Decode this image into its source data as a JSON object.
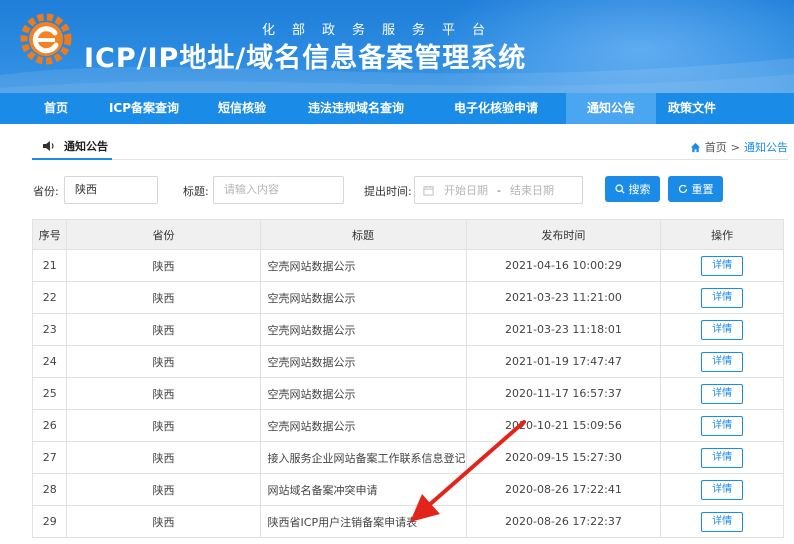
{
  "header": {
    "subtitle": "化部政务服务平台",
    "title": "ICP/IP地址/域名信息备案管理系统"
  },
  "nav": {
    "items": [
      {
        "label": "首页"
      },
      {
        "label": "ICP备案查询"
      },
      {
        "label": "短信核验"
      },
      {
        "label": "违法违规域名查询"
      },
      {
        "label": "电子化核验申请"
      },
      {
        "label": "通知公告",
        "active": true
      },
      {
        "label": "政策文件"
      }
    ]
  },
  "section": {
    "tab_label": "通知公告",
    "breadcrumb": {
      "home": "首页",
      "separator": ">",
      "current": "通知公告"
    }
  },
  "filters": {
    "province_label": "省份:",
    "province_value": "陕西",
    "title_label": "标题:",
    "title_placeholder": "请输入内容",
    "date_label": "提出时间:",
    "start_placeholder": "开始日期",
    "date_separator": "-",
    "end_placeholder": "结束日期",
    "search_label": "搜索",
    "reset_label": "重置"
  },
  "table": {
    "headers": [
      "序号",
      "省份",
      "标题",
      "发布时间",
      "操作"
    ],
    "action_label": "详情",
    "rows": [
      {
        "no": "21",
        "province": "陕西",
        "title": "空壳网站数据公示",
        "time": "2021-04-16 10:00:29"
      },
      {
        "no": "22",
        "province": "陕西",
        "title": "空壳网站数据公示",
        "time": "2021-03-23 11:21:00"
      },
      {
        "no": "23",
        "province": "陕西",
        "title": "空壳网站数据公示",
        "time": "2021-03-23 11:18:01"
      },
      {
        "no": "24",
        "province": "陕西",
        "title": "空壳网站数据公示",
        "time": "2021-01-19 17:47:47"
      },
      {
        "no": "25",
        "province": "陕西",
        "title": "空壳网站数据公示",
        "time": "2020-11-17 16:57:37"
      },
      {
        "no": "26",
        "province": "陕西",
        "title": "空壳网站数据公示",
        "time": "2020-10-21 15:09:56"
      },
      {
        "no": "27",
        "province": "陕西",
        "title": "接入服务企业网站备案工作联系信息登记",
        "time": "2020-09-15 15:27:30"
      },
      {
        "no": "28",
        "province": "陕西",
        "title": "网站域名备案冲突申请",
        "time": "2020-08-26 17:22:41"
      },
      {
        "no": "29",
        "province": "陕西",
        "title": "陕西省ICP用户注销备案申请表",
        "time": "2020-08-26 17:22:37"
      }
    ]
  },
  "colors": {
    "primary": "#1a8be6",
    "nav_active": "#4aa6f0",
    "annotation_arrow": "#e3241b"
  },
  "icons": [
    "logo-icon",
    "speaker-icon",
    "home-icon",
    "calendar-icon",
    "search-icon",
    "refresh-icon",
    "red-arrow-annotation"
  ]
}
